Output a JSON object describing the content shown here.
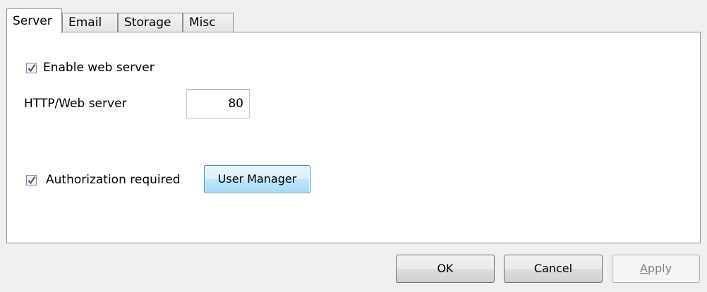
{
  "tabs": [
    {
      "label": "Server",
      "active": true
    },
    {
      "label": "Email",
      "active": false
    },
    {
      "label": "Storage",
      "active": false
    },
    {
      "label": "Misc",
      "active": false
    }
  ],
  "server": {
    "enable_web_server": {
      "label": "Enable web server",
      "checked": true
    },
    "http_port": {
      "label": "HTTP/Web server",
      "value": "80"
    },
    "authorization": {
      "label": "Authorization required",
      "checked": true
    },
    "user_manager_label": "User Manager"
  },
  "footer": {
    "ok_label": "OK",
    "cancel_label": "Cancel",
    "apply_label": "Apply"
  },
  "colors": {
    "panel_bg": "#ffffff",
    "dialog_bg": "#f0f0f0",
    "check_color": "#4a5f97",
    "focus_border": "#3c7fb1",
    "disabled_text": "#838383"
  }
}
